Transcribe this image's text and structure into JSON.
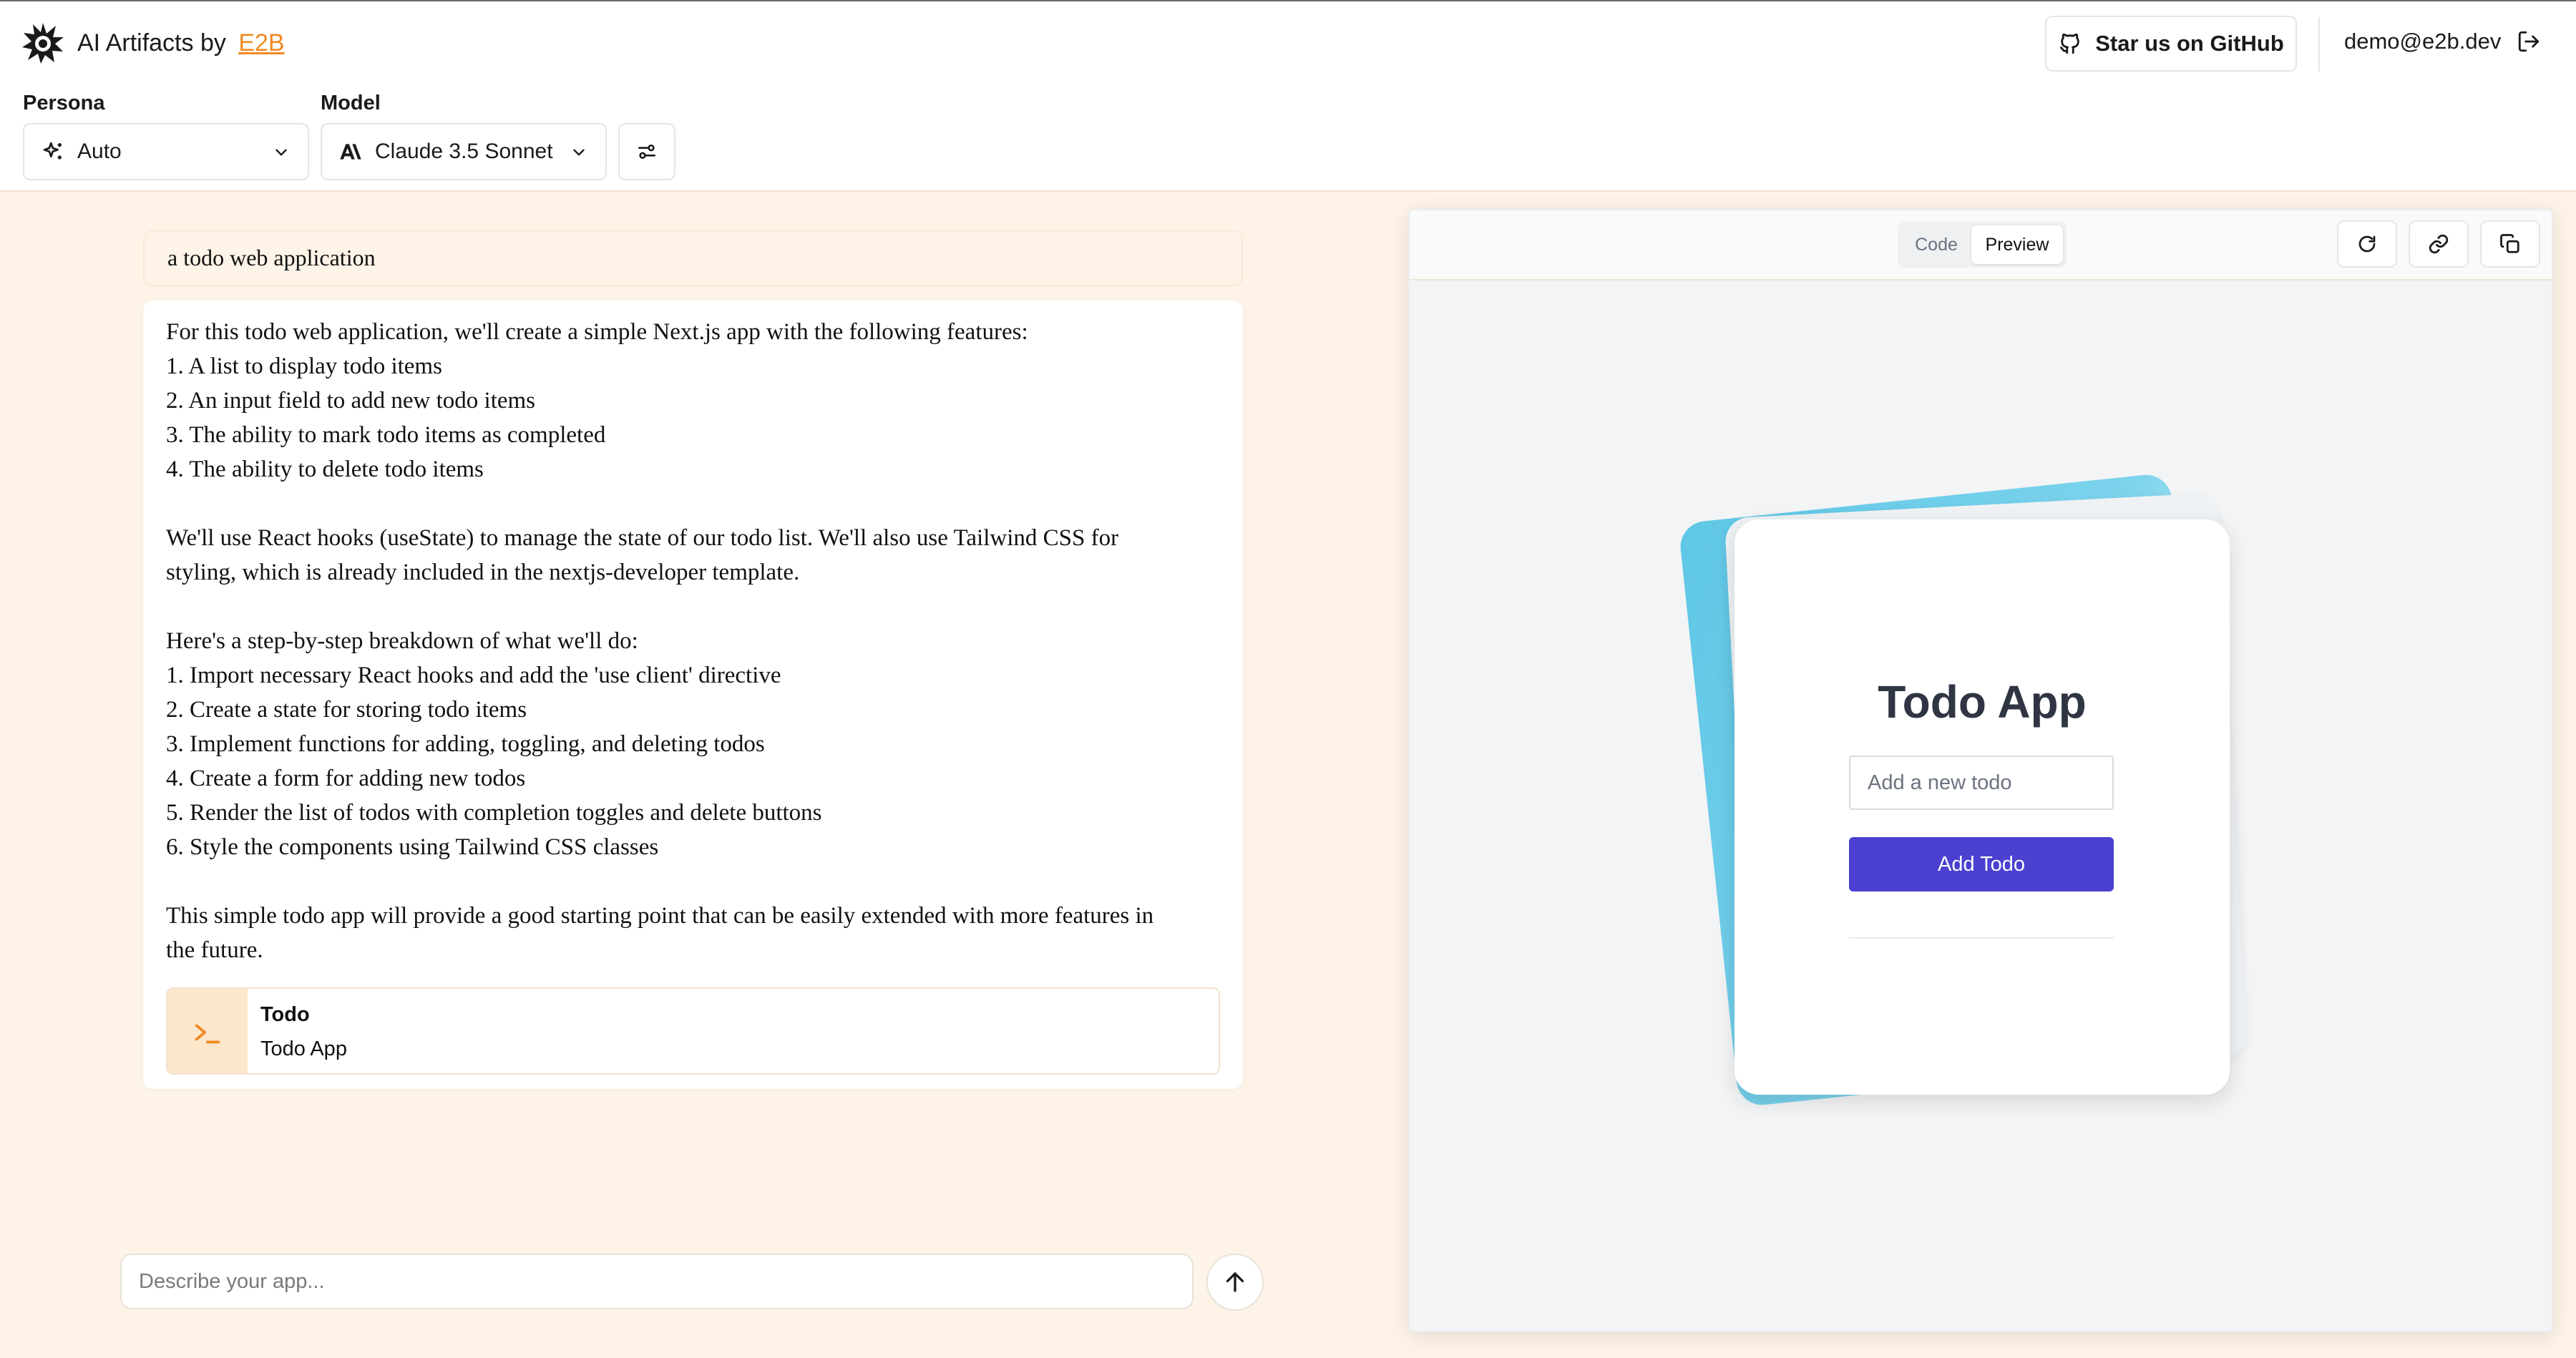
{
  "header": {
    "brand_prefix": "AI Artifacts by ",
    "brand_link": "E2B",
    "github_label": "Star us on GitHub",
    "user_email": "demo@e2b.dev"
  },
  "controls": {
    "persona_label": "Persona",
    "persona_value": "Auto",
    "model_label": "Model",
    "model_value": "Claude 3.5 Sonnet"
  },
  "chat": {
    "user_message": "a todo web application",
    "ai_lines": [
      "For this todo web application, we'll create a simple Next.js app with the following features:",
      "1. A list to display todo items",
      "2. An input field to add new todo items",
      "3. The ability to mark todo items as completed",
      "4. The ability to delete todo items",
      "",
      "We'll use React hooks (useState) to manage the state of our todo list. We'll also use Tailwind CSS for",
      "styling, which is already included in the nextjs-developer template.",
      "",
      "Here's a step-by-step breakdown of what we'll do:",
      "1. Import necessary React hooks and add the 'use client' directive",
      "2. Create a state for storing todo items",
      "3. Implement functions for adding, toggling, and deleting todos",
      "4. Create a form for adding new todos",
      "5. Render the list of todos with completion toggles and delete buttons",
      "6. Style the components using Tailwind CSS classes",
      "",
      "This simple todo app will provide a good starting point that can be easily extended with more features in",
      "the future."
    ],
    "artifact": {
      "title": "Todo",
      "subtitle": "Todo App"
    },
    "input_placeholder": "Describe your app..."
  },
  "preview": {
    "tabs": {
      "code": "Code",
      "preview": "Preview"
    },
    "active_tab": "Preview",
    "app": {
      "title": "Todo App",
      "input_placeholder": "Add a new todo",
      "add_button": "Add Todo"
    }
  },
  "colors": {
    "accent": "#f08a24",
    "background": "#fdf3e7",
    "primary_button": "#4b40d0"
  }
}
